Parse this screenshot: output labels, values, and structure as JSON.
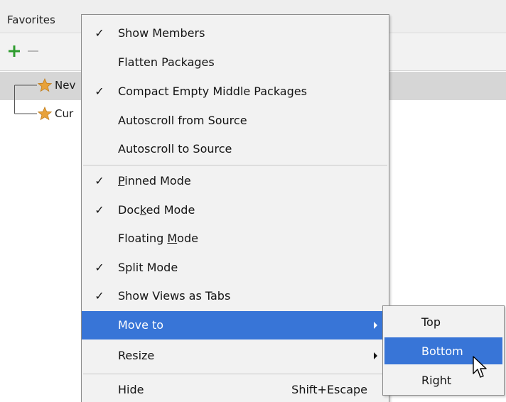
{
  "tool_window": {
    "title": "Favorites",
    "toolbar": {
      "add_icon": "plus-icon",
      "remove_icon": "minus-icon",
      "add_color": "#2e9c2e",
      "remove_color": "#b8b8b8"
    },
    "tree": [
      {
        "label": "Nev",
        "icon": "star-icon",
        "selected": true
      },
      {
        "label": "Cur",
        "icon": "star-icon",
        "selected": false
      }
    ]
  },
  "menu": {
    "items": [
      {
        "label": "Show Members",
        "checked": true
      },
      {
        "label": "Flatten Packages",
        "checked": false
      },
      {
        "label": "Compact Empty Middle Packages",
        "checked": true
      },
      {
        "label": "Autoscroll from Source",
        "checked": false
      },
      {
        "label": "Autoscroll to Source",
        "checked": false
      },
      {
        "label_pre": "",
        "label_mnemonic": "P",
        "label_post": "inned Mode",
        "checked": true
      },
      {
        "label_pre": "Doc",
        "label_mnemonic": "k",
        "label_post": "ed Mode",
        "checked": true
      },
      {
        "label_pre": "Floating ",
        "label_mnemonic": "M",
        "label_post": "ode",
        "checked": false
      },
      {
        "label": "Split Mode",
        "checked": true
      },
      {
        "label": "Show Views as Tabs",
        "checked": true
      },
      {
        "label": "Move to",
        "checked": false,
        "submenu": true,
        "highlighted": true
      },
      {
        "label": "Resize",
        "checked": false,
        "submenu": true
      },
      {
        "label": "Hide",
        "shortcut": "Shift+Escape",
        "checked": false
      }
    ],
    "check_glyph": "✓"
  },
  "submenu": {
    "items": [
      {
        "label": "Top"
      },
      {
        "label": "Bottom",
        "highlighted": true
      },
      {
        "label": "Right"
      }
    ]
  },
  "colors": {
    "highlight": "#3875d7",
    "menu_bg": "#f2f2f2",
    "star": "#e8a23a"
  }
}
